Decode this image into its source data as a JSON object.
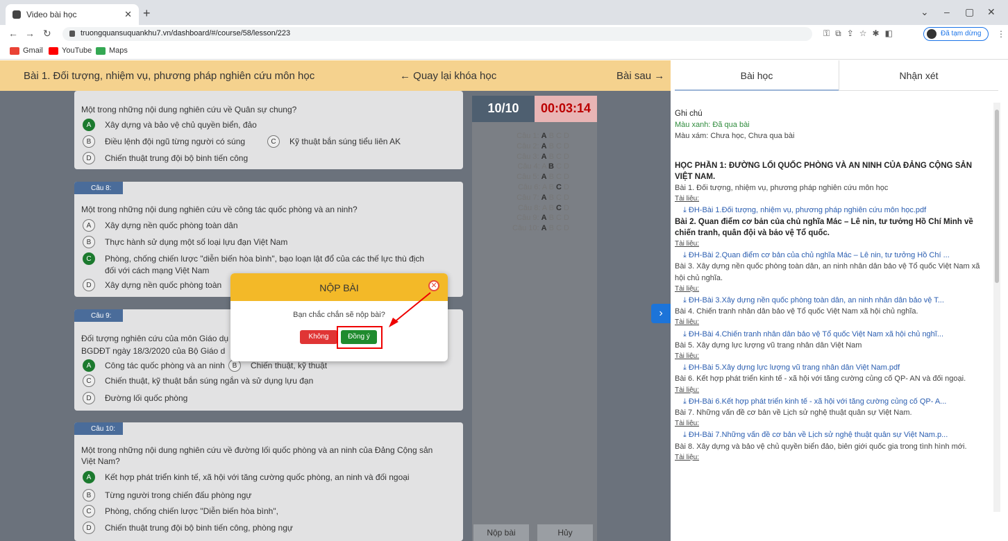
{
  "browser": {
    "tab_title": "Video bài học",
    "url": "truongquansuquankhu7.vn/dashboard/#/course/58/lesson/223",
    "profile": "Đã tạm dừng"
  },
  "bookmarks": [
    {
      "label": "Gmail"
    },
    {
      "label": "YouTube"
    },
    {
      "label": "Maps"
    }
  ],
  "header": {
    "lesson_title": "Bài 1. Đối tượng, nhiệm vụ, phương pháp nghiên cứu môn học",
    "back": "← Quay lại khóa học",
    "next": "Bài sau →"
  },
  "questions": [
    {
      "label": "",
      "text": "Một trong những nội dung nghiên cứu về Quân sự chung?",
      "options": [
        {
          "l": "A",
          "t": "Xây dựng và bảo vệ chủ quyền biển, đảo",
          "sel": true
        },
        {
          "l": "B",
          "t": "Điều lệnh đội ngũ từng người có súng"
        },
        {
          "l": "C",
          "t": "Kỹ thuật bắn súng tiểu liên AK"
        },
        {
          "l": "D",
          "t": "Chiến thuật trung đội bộ binh tiến công"
        }
      ]
    },
    {
      "label": "Câu 8:",
      "text": "Một trong những nội dung nghiên cứu về công tác quốc phòng và an ninh?",
      "options": [
        {
          "l": "A",
          "t": "Xây dựng nền quốc phòng toàn dân"
        },
        {
          "l": "B",
          "t": "Thực hành sử dụng một số loại lựu đạn Việt Nam"
        },
        {
          "l": "C",
          "t": "Phòng, chống chiến lược \"diễn biến hòa bình\", bạo loạn lật đổ của các thế lực thù địch",
          "t2": "đối với cách mạng Việt Nam",
          "sel": true
        },
        {
          "l": "D",
          "t": "Xây dựng nền quốc phòng toàn"
        }
      ]
    },
    {
      "label": "Câu 9:",
      "text": "Đối tượng nghiên cứu của môn Giáo dụ",
      "text2": "BGDĐT ngày 18/3/2020 của Bộ Giáo d",
      "options": [
        {
          "l": "A",
          "t": "Công tác quốc phòng và an ninh",
          "sel": true
        },
        {
          "l": "B",
          "t": "Chiến thuật, kỹ thuật"
        },
        {
          "l": "C",
          "t": "Chiến thuật, kỹ thuật bắn súng ngắn và sử dụng lựu đạn"
        },
        {
          "l": "D",
          "t": "Đường lối quốc phòng"
        }
      ]
    },
    {
      "label": "Câu 10:",
      "text": "Một trong những nội dung nghiên cứu về đường lối quốc phòng và an ninh của Đảng Cộng sản",
      "text2": "Việt Nam?",
      "options": [
        {
          "l": "A",
          "t": "Kết hợp phát triển kinh tế, xã hội với tăng cường quốc phòng, an ninh và đối ngoại",
          "sel": true
        },
        {
          "l": "B",
          "t": "Từng người trong chiến đấu phòng ngự"
        },
        {
          "l": "C",
          "t": "Phòng, chống chiến lược \"Diễn biến hòa bình\","
        },
        {
          "l": "D",
          "t": "Chiến thuật trung đội bộ binh tiến công, phòng ngự"
        }
      ]
    }
  ],
  "sidebar": {
    "counter": "10/10",
    "timer": "00:03:14",
    "list": [
      {
        "label": "Câu 1:",
        "ans": "A"
      },
      {
        "label": "Câu 2:",
        "ans": "A"
      },
      {
        "label": "Câu 3:",
        "ans": "A"
      },
      {
        "label": "Câu 4:",
        "ans": "B"
      },
      {
        "label": "Câu 5:",
        "ans": "A"
      },
      {
        "label": "Câu 6:",
        "ans": "C"
      },
      {
        "label": "Câu 7:",
        "ans": "A"
      },
      {
        "label": "Câu 8:",
        "ans": "C"
      },
      {
        "label": "Câu 9:",
        "ans": "A"
      },
      {
        "label": "Câu 10:",
        "ans": "A"
      }
    ],
    "submit": "Nộp bài",
    "cancel": "Hủy"
  },
  "modal": {
    "title": "NỘP BÀI",
    "question": "Bạn chắc chắn sẽ nộp bài?",
    "no": "Không",
    "yes": "Đồng ý"
  },
  "right": {
    "tab1": "Bài học",
    "tab2": "Nhận xét",
    "note": "Ghi chú",
    "green": "Màu xanh: Đã qua bài",
    "gray": "Màu xám: Chưa học, Chưa qua bài",
    "part": "HỌC PHẦN 1: ĐƯỜNG LỐI QUỐC PHÒNG VÀ AN NINH CỦA ĐẢNG CỘNG SẢN VIỆT NAM.",
    "doc": "Tài liệu:",
    "lessons": [
      {
        "t": "Bài 1. Đối tượng, nhiệm vụ, phương pháp nghiên cứu môn học",
        "f": "ĐH-Bài 1.Đối tượng, nhiệm vụ, phương pháp nghiên cứu môn học.pdf"
      },
      {
        "t": "Bài 2. Quan điểm cơ bản của chủ nghĩa Mác – Lê nin, tư tưởng Hồ Chí Minh về chiến tranh, quân đội và bảo vệ Tổ quốc.",
        "f": "ĐH-Bài 2.Quan điểm cơ bản của chủ nghĩa Mác – Lê nin, tư tưởng Hồ Chí ...",
        "bold": true
      },
      {
        "t": "Bài 3. Xây dựng nền quốc phòng toàn dân, an ninh nhân dân bảo vệ Tổ quốc Việt Nam xã hội chủ nghĩa.",
        "f": "ĐH-Bài 3.Xây dựng nền quốc phòng toàn dân, an ninh nhân dân bảo vệ T..."
      },
      {
        "t": "Bài 4. Chiến tranh nhân dân bảo vệ Tổ quốc Việt Nam xã hội chủ nghĩa.",
        "f": "ĐH-Bài 4.Chiến tranh nhân dân bảo vệ Tổ quốc Việt Nam xã hội chủ nghĩ..."
      },
      {
        "t": "Bài 5. Xây dựng lực lượng vũ trang nhân dân Việt Nam",
        "f": "ĐH-Bài 5.Xây dựng lực lượng vũ trang nhân dân Việt Nam.pdf"
      },
      {
        "t": "Bài 6. Kết hợp phát triển kinh tế - xã hội với tăng cường củng cố QP- AN và đối ngoại.",
        "f": "ĐH-Bài 6.Kết hợp phát triển kinh tế - xã hội với tăng cường củng cố QP- A..."
      },
      {
        "t": "Bài 7. Những vấn đề cơ bản về Lịch sử nghệ thuật quân sự Việt Nam.",
        "f": "ĐH-Bài 7.Những vấn đề cơ bản về Lịch sử nghệ thuật quân sự Việt Nam.p..."
      },
      {
        "t": "Bài 8. Xây dựng và bảo vệ chủ quyền biển đảo, biên giới quốc gia trong tình hình mới.",
        "f": ""
      }
    ]
  }
}
